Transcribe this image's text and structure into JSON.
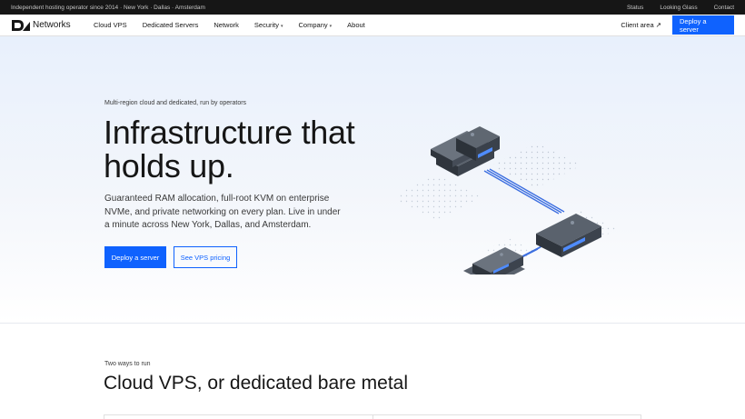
{
  "topbar": {
    "tagline": "Independent hosting operator since 2014 · New York · Dallas · Amsterdam",
    "links": [
      "Status",
      "Looking Glass",
      "Contact"
    ]
  },
  "nav": {
    "logo_text": "Networks",
    "links": [
      {
        "label": "Cloud VPS"
      },
      {
        "label": "Dedicated Servers"
      },
      {
        "label": "Network"
      },
      {
        "label": "Security",
        "caret": "▾"
      },
      {
        "label": "Company",
        "caret": "▾"
      },
      {
        "label": "About"
      }
    ],
    "client_area": "Client area ↗",
    "deploy": "Deploy a server"
  },
  "hero": {
    "eyebrow": "Multi-region cloud and dedicated, run by operators",
    "headline_line1": "Infrastructure that",
    "headline_line2": "holds up.",
    "lede": "Guaranteed RAM allocation, full-root KVM on enterprise NVMe, and private networking on every plan. Live in under a minute across New York, Dallas, and Amsterdam.",
    "primary_cta": "Deploy a server",
    "secondary_cta": "See VPS pricing"
  },
  "section": {
    "eyebrow": "Two ways to run",
    "title": "Cloud VPS, or dedicated bare metal"
  },
  "colors": {
    "accent": "#0f62fe",
    "topbar_bg": "#161616",
    "server_dark": "#3c434d",
    "server_light": "#5a626d",
    "led": "#4f8cff"
  }
}
